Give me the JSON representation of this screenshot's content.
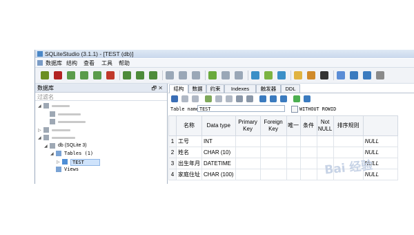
{
  "window": {
    "title": "SQLiteStudio (3.1.1) - [TEST (db)]"
  },
  "menu": [
    "数据库",
    "结构",
    "查看",
    "工具",
    "帮助"
  ],
  "toolbar_icons": [
    {
      "name": "connect-icon",
      "color": "#6b8e23"
    },
    {
      "name": "disconnect-icon",
      "color": "#b22222"
    },
    {
      "name": "db-add-icon",
      "color": "#5a9b4b"
    },
    {
      "name": "db-edit-icon",
      "color": "#5a9b4b"
    },
    {
      "name": "db-delete-icon",
      "color": "#5a9b4b"
    },
    {
      "name": "db-refresh-icon",
      "color": "#c0392b"
    },
    {
      "name": "table-add-icon",
      "color": "#4d8b3a"
    },
    {
      "name": "table-edit-icon",
      "color": "#4d8b3a"
    },
    {
      "name": "table-delete-icon",
      "color": "#4d8b3a"
    },
    {
      "name": "index-add-icon",
      "color": "#9aa7b7"
    },
    {
      "name": "index-edit-icon",
      "color": "#9aa7b7"
    },
    {
      "name": "index-delete-icon",
      "color": "#9aa7b7"
    },
    {
      "name": "trigger-add-icon",
      "color": "#6aaa3c"
    },
    {
      "name": "trigger-edit-icon",
      "color": "#9aa7b7"
    },
    {
      "name": "trigger-delete-icon",
      "color": "#9aa7b7"
    },
    {
      "name": "view-add-icon",
      "color": "#3b8fc7"
    },
    {
      "name": "view-edit-icon",
      "color": "#7cb342"
    },
    {
      "name": "view-delete-icon",
      "color": "#3b8fc7"
    },
    {
      "name": "sql-editor-icon",
      "color": "#e0b341"
    },
    {
      "name": "import-icon",
      "color": "#d08a2a"
    },
    {
      "name": "function-icon",
      "color": "#333333"
    },
    {
      "name": "collation-icon",
      "color": "#5b8dd6"
    },
    {
      "name": "tile-icon",
      "color": "#3b7bbf"
    },
    {
      "name": "cascade-icon",
      "color": "#3b7bbf"
    },
    {
      "name": "config-icon",
      "color": "#8a8a8a"
    }
  ],
  "left_panel": {
    "title": "数据库",
    "controls": "🗗 ✕",
    "filter_placeholder": "过滤名",
    "tree": [
      {
        "level": 0,
        "text": "",
        "blurred": true,
        "expander": "◢"
      },
      {
        "level": 1,
        "text": "",
        "blurred": true
      },
      {
        "level": 1,
        "text": "",
        "blurred": true
      },
      {
        "level": 0,
        "text": "",
        "blurred": true,
        "expander": "▷"
      },
      {
        "level": 0,
        "text": "",
        "blurred": true,
        "expander": "◢"
      },
      {
        "level": 1,
        "text": "db (SQLite 3)",
        "expander": "◢"
      },
      {
        "level": 2,
        "text": "Tables (1)",
        "expander": "◢"
      },
      {
        "level": 3,
        "text": "TEST",
        "expander": "▷",
        "selected": true
      },
      {
        "level": 2,
        "text": "Views"
      }
    ]
  },
  "tabs": [
    "结构",
    "数据",
    "约束",
    "Indexes",
    "触发器",
    "DDL"
  ],
  "active_tab": "结构",
  "struct_toolbar_icons": [
    "refresh-icon",
    "commit-icon",
    "rollback-icon",
    "add-column-icon",
    "edit-column-icon",
    "delete-column-icon",
    "move-up-icon",
    "move-down-icon",
    "add-constraint-icon",
    "edit-constraint-icon",
    "delete-constraint-icon",
    "create-similar-icon",
    "reset-icon"
  ],
  "table_name": {
    "label": "Table name:",
    "value": "TEST"
  },
  "without_rowid": {
    "label": "WITHOUT ROWID",
    "checked": false
  },
  "columns_header": [
    "",
    "名称",
    "Data type",
    "Primary Key",
    "Foreign Key",
    "唯一",
    "条件",
    "Not NULL",
    "排序规则",
    ""
  ],
  "rows": [
    {
      "n": "1",
      "name": "工号",
      "type": "INT",
      "default": "NULL"
    },
    {
      "n": "2",
      "name": "姓名",
      "type": "CHAR (10)",
      "default": "NULL"
    },
    {
      "n": "3",
      "name": "出生年月",
      "type": "DATETIME",
      "default": "NULL"
    },
    {
      "n": "4",
      "name": "家庭住址",
      "type": "CHAR (100)",
      "default": "NULL"
    }
  ],
  "watermark": "Bai 经验"
}
